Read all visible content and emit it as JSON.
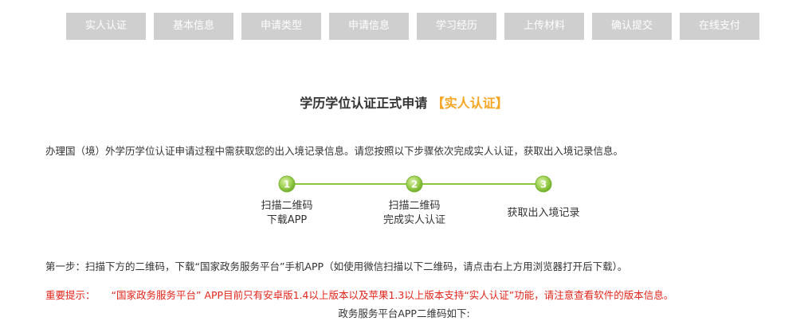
{
  "nav": {
    "tabs": [
      {
        "label": "实人认证"
      },
      {
        "label": "基本信息"
      },
      {
        "label": "申请类型"
      },
      {
        "label": "申请信息"
      },
      {
        "label": "学习经历"
      },
      {
        "label": "上传材料"
      },
      {
        "label": "确认提交"
      },
      {
        "label": "在线支付"
      }
    ]
  },
  "title": {
    "main": "学历学位认证正式申请",
    "highlight": "【实人认证】",
    "highlight_color": "#f5a623"
  },
  "intro": "办理国（境）外学历学位认证申请过程中需获取您的出入境记录信息。请您按照以下步骤依次完成实人认证，获取出入境记录信息。",
  "progress": {
    "steps": [
      {
        "number": "1",
        "line1": "扫描二维码",
        "line2": "下载APP"
      },
      {
        "number": "2",
        "line1": "扫描二维码",
        "line2": "完成实人认证"
      },
      {
        "number": "3",
        "line1": "获取出入境记录",
        "line2": ""
      }
    ],
    "accent_color": "#8cc63f"
  },
  "step_one": "第一步：扫描下方的二维码，下载“国家政务服务平台”手机APP（如使用微信扫描以下二维码，请点击右上方用浏览器打开后下载）。",
  "notice": {
    "label": "重要提示：",
    "text": "“国家政务服务平台” APP目前只有安卓版1.4以上版本以及苹果1.3以上版本支持“实人认证”功能，请注意查看软件的版本信息。",
    "color": "#e0261b"
  },
  "qr_caption": "政务服务平台APP二维码如下:"
}
